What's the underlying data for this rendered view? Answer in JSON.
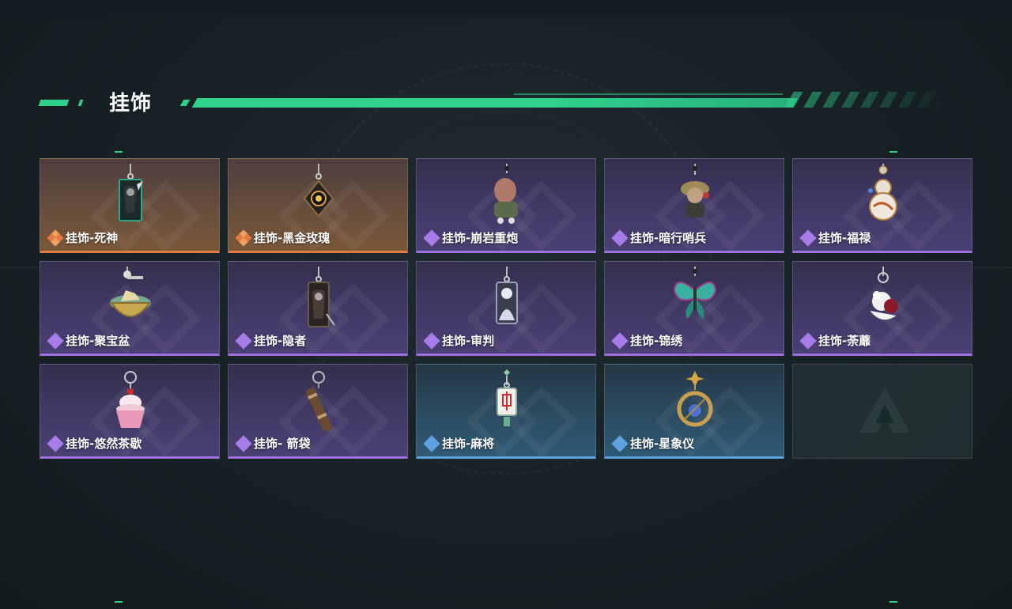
{
  "header": {
    "title": "挂饰"
  },
  "colors": {
    "accent": "#2fd18c",
    "legendary": "#e07a3f",
    "epic": "#9f6fe0",
    "rare": "#5ea0e0"
  },
  "items": [
    {
      "label": "挂饰-死神",
      "rarity": "orange",
      "icon": "reaper-card-charm-icon"
    },
    {
      "label": "挂饰-黑金玫瑰",
      "rarity": "orange",
      "icon": "black-gold-rose-charm-icon"
    },
    {
      "label": "挂饰-崩岩重炮",
      "rarity": "purple",
      "icon": "heavy-cannon-doll-charm-icon"
    },
    {
      "label": "挂饰-暗行哨兵",
      "rarity": "purple",
      "icon": "shadow-sentinel-doll-charm-icon"
    },
    {
      "label": "挂饰-福禄",
      "rarity": "purple",
      "icon": "gourd-charm-icon"
    },
    {
      "label": "挂饰-聚宝盆",
      "rarity": "purple",
      "icon": "treasure-bowl-charm-icon"
    },
    {
      "label": "挂饰-隐者",
      "rarity": "purple",
      "icon": "hermit-card-charm-icon"
    },
    {
      "label": "挂饰-审判",
      "rarity": "purple",
      "icon": "judgement-card-charm-icon"
    },
    {
      "label": "挂饰-锦绣",
      "rarity": "purple",
      "icon": "butterfly-charm-icon"
    },
    {
      "label": "挂饰-荼蘼",
      "rarity": "purple",
      "icon": "flower-doll-charm-icon"
    },
    {
      "label": "挂饰-悠然茶歇",
      "rarity": "purple",
      "icon": "cupcake-charm-icon"
    },
    {
      "label": "挂饰- 箭袋",
      "rarity": "purple",
      "icon": "quiver-charm-icon"
    },
    {
      "label": "挂饰-麻将",
      "rarity": "blue",
      "icon": "mahjong-tile-charm-icon"
    },
    {
      "label": "挂饰-星象仪",
      "rarity": "blue",
      "icon": "astrolabe-charm-icon"
    }
  ],
  "empty_slot": {
    "icon": "game-logo-icon"
  }
}
